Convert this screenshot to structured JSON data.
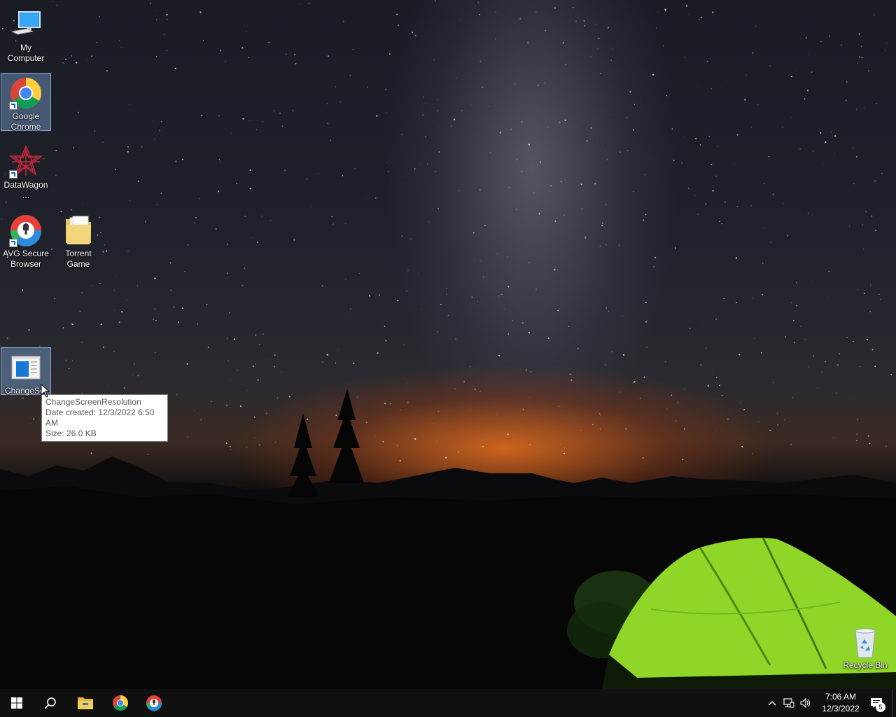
{
  "desktop": {
    "icons": [
      {
        "label": "My Computer",
        "icon": "computer-icon",
        "selected": false
      },
      {
        "label": "Google Chrome",
        "icon": "chrome-icon",
        "selected": true
      },
      {
        "label": "DataWagon...",
        "icon": "datawagon-icon",
        "selected": false
      },
      {
        "label": "AVG Secure Browser",
        "icon": "avg-browser-icon",
        "selected": false
      },
      {
        "label": "Torrent Game",
        "icon": "folder-icon",
        "selected": false
      },
      {
        "label": "ChangeScr",
        "icon": "change-screen-resolution-icon",
        "selected": true
      },
      {
        "label": "Recycle Bin",
        "icon": "recycle-bin-icon",
        "selected": false
      }
    ],
    "tooltip": {
      "name": "ChangeScreenResolution",
      "date_created": "Date created: 12/3/2022 6:50 AM",
      "size": "Size: 26.0 KB"
    }
  },
  "taskbar": {
    "start": "windows-start-icon",
    "search": "search-icon",
    "pinned": [
      "file-explorer-icon",
      "chrome-icon",
      "avg-browser-icon"
    ],
    "tray": {
      "icons": [
        "chevron-up-icon",
        "network-icon",
        "volume-icon"
      ],
      "time": "7:06 AM",
      "date": "12/3/2022",
      "notification_count": "5"
    }
  },
  "colors": {
    "taskbar_bg": "#101010",
    "selection_bg": "#6e94c8",
    "tent_green": "#8fd629",
    "horizon_orange": "#e06a20"
  }
}
